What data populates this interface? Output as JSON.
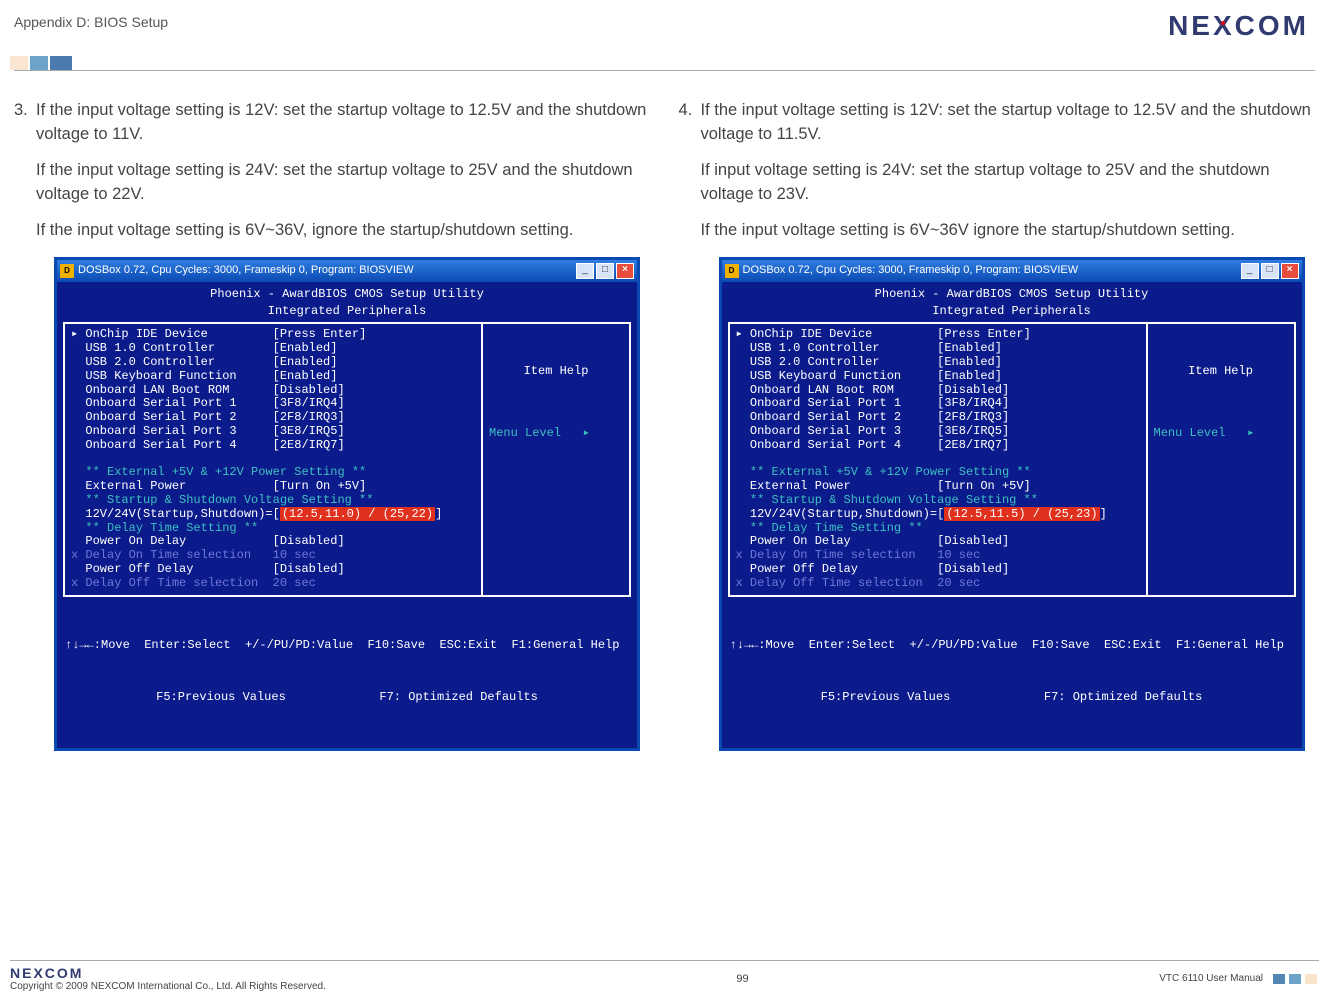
{
  "header": {
    "appendix": "Appendix D: BIOS Setup",
    "logo": "NEXCOM"
  },
  "left": {
    "num": "3.",
    "p1": "If the input voltage setting is 12V: set the startup voltage to 12.5V and the shutdown voltage to 11V.",
    "p2": "If the input voltage setting is 24V: set the startup voltage to 25V and the shutdown voltage to 22V.",
    "p3": "If the input voltage setting is 6V~36V, ignore the startup/shutdown setting.",
    "bios": {
      "titlebar": "DOSBox 0.72, Cpu Cycles:    3000, Frameskip  0, Program: BIOSVIEW",
      "title1": "Phoenix - AwardBIOS CMOS Setup Utility",
      "title2": "Integrated Peripherals",
      "rows": [
        {
          "k": "OnChip IDE Device",
          "v": "[Press Enter]",
          "arrow": true
        },
        {
          "k": "USB 1.0 Controller",
          "v": "[Enabled]"
        },
        {
          "k": "USB 2.0 Controller",
          "v": "[Enabled]"
        },
        {
          "k": "USB Keyboard Function",
          "v": "[Enabled]"
        },
        {
          "k": "Onboard LAN Boot ROM",
          "v": "[Disabled]"
        },
        {
          "k": "Onboard Serial Port 1",
          "v": "[3F8/IRQ4]"
        },
        {
          "k": "Onboard Serial Port 2",
          "v": "[2F8/IRQ3]"
        },
        {
          "k": "Onboard Serial Port 3",
          "v": "[3E8/IRQ5]"
        },
        {
          "k": "Onboard Serial Port 4",
          "v": "[2E8/IRQ7]"
        }
      ],
      "sec1": "** External +5V & +12V Power Setting **",
      "extpwr_k": "External Power",
      "extpwr_v": "[Turn On +5V]",
      "sec2": "** Startup & Shutdown Voltage Setting **",
      "ssline_k": "12V/24V(Startup,Shutdown)=[",
      "ssline_hl": "(12.5,11.0) / (25,22)",
      "ssline_end": "]",
      "sec3": "** Delay Time Setting **",
      "pod_k": "Power On Delay",
      "pod_v": "[Disabled]",
      "don_k": "x Delay On Time selection",
      "don_v": "10 sec",
      "poff_k": "Power Off Delay",
      "poff_v": "[Disabled]",
      "doff_k": "x Delay Off Time selection",
      "doff_v": "20 sec",
      "help_title": "Item Help",
      "help_level": "Menu Level   ▸",
      "footer1": "↑↓→←:Move  Enter:Select  +/-/PU/PD:Value  F10:Save  ESC:Exit  F1:General Help",
      "footer2": "F5:Previous Values             F7: Optimized Defaults"
    }
  },
  "right": {
    "num": "4.",
    "p1": "If the input voltage setting is 12V: set the startup voltage to 12.5V and the shutdown voltage to 11.5V.",
    "p2": "If input voltage setting is 24V: set the startup voltage to 25V and the shutdown voltage to 23V.",
    "p3": "If the input voltage setting is 6V~36V ignore the startup/shutdown setting.",
    "bios": {
      "titlebar": "DOSBox 0.72, Cpu Cycles:    3000, Frameskip  0, Program: BIOSVIEW",
      "title1": "Phoenix - AwardBIOS CMOS Setup Utility",
      "title2": "Integrated Peripherals",
      "rows": [
        {
          "k": "OnChip IDE Device",
          "v": "[Press Enter]",
          "arrow": true
        },
        {
          "k": "USB 1.0 Controller",
          "v": "[Enabled]"
        },
        {
          "k": "USB 2.0 Controller",
          "v": "[Enabled]"
        },
        {
          "k": "USB Keyboard Function",
          "v": "[Enabled]"
        },
        {
          "k": "Onboard LAN Boot ROM",
          "v": "[Disabled]"
        },
        {
          "k": "Onboard Serial Port 1",
          "v": "[3F8/IRQ4]"
        },
        {
          "k": "Onboard Serial Port 2",
          "v": "[2F8/IRQ3]"
        },
        {
          "k": "Onboard Serial Port 3",
          "v": "[3E8/IRQ5]"
        },
        {
          "k": "Onboard Serial Port 4",
          "v": "[2E8/IRQ7]"
        }
      ],
      "sec1": "** External +5V & +12V Power Setting **",
      "extpwr_k": "External Power",
      "extpwr_v": "[Turn On +5V]",
      "sec2": "** Startup & Shutdown Voltage Setting **",
      "ssline_k": "12V/24V(Startup,Shutdown)=[",
      "ssline_hl": "(12.5,11.5) / (25,23)",
      "ssline_end": "]",
      "sec3": "** Delay Time Setting **",
      "pod_k": "Power On Delay",
      "pod_v": "[Disabled]",
      "don_k": "x Delay On Time selection",
      "don_v": "10 sec",
      "poff_k": "Power Off Delay",
      "poff_v": "[Disabled]",
      "doff_k": "x Delay Off Time selection",
      "doff_v": "20 sec",
      "help_title": "Item Help",
      "help_level": "Menu Level   ▸",
      "footer1": "↑↓→←:Move  Enter:Select  +/-/PU/PD:Value  F10:Save  ESC:Exit  F1:General Help",
      "footer2": "F5:Previous Values             F7: Optimized Defaults"
    }
  },
  "footer": {
    "logo": "NEXCOM",
    "copyright": "Copyright © 2009 NEXCOM International Co., Ltd. All Rights Reserved.",
    "page": "99",
    "manual": "VTC 6110 User Manual"
  }
}
